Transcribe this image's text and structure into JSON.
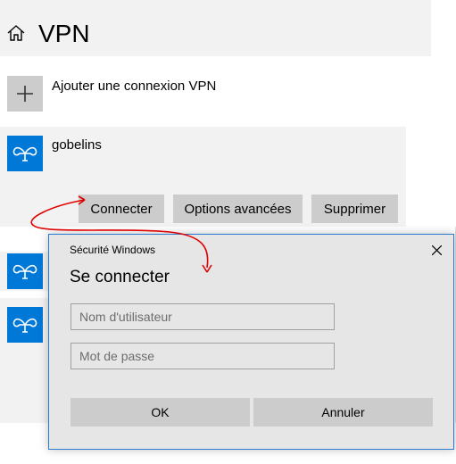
{
  "header": {
    "title": "VPN",
    "home_icon": "home-icon"
  },
  "add_connection": {
    "label": "Ajouter une connexion VPN",
    "icon": "plus-icon"
  },
  "vpn": {
    "name": "gobelins",
    "icon": "vpn-icon",
    "accent": "#0078d7",
    "buttons": {
      "connect": "Connecter",
      "advanced": "Options avancées",
      "remove": "Supprimer"
    }
  },
  "dialog": {
    "caption": "Sécurité Windows",
    "heading": "Se connecter",
    "username_placeholder": "Nom d'utilisateur",
    "password_placeholder": "Mot de passe",
    "ok_label": "OK",
    "cancel_label": "Annuler",
    "border_color": "#2b7bd0"
  },
  "annotation": {
    "arrow_color": "#e00000"
  }
}
